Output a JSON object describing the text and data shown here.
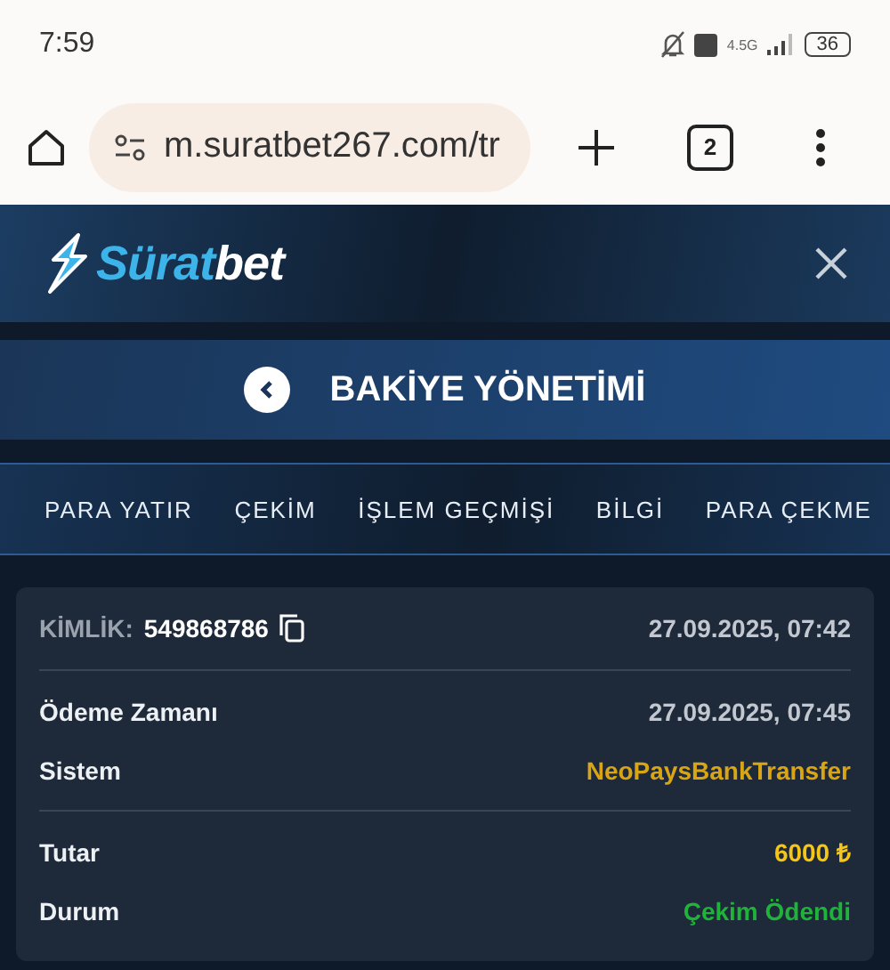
{
  "status_bar": {
    "time": "7:59",
    "network": "4.5G",
    "battery": "36"
  },
  "browser": {
    "url": "m.suratbet267.com/tr",
    "tab_count": "2"
  },
  "header": {
    "logo": [
      "Sürat",
      "bet"
    ]
  },
  "page_title": "BAKİYE YÖNETİMİ",
  "tabs": [
    {
      "label": "PARA YATIR",
      "selected": false
    },
    {
      "label": "ÇEKİM",
      "selected": false
    },
    {
      "label": "İŞLEM GEÇMİŞİ",
      "selected": false
    },
    {
      "label": "BİLGİ",
      "selected": false
    },
    {
      "label": "PARA ÇEKME",
      "selected": false
    }
  ],
  "card": {
    "id_label": "KİMLİK:",
    "id_value": "549868786",
    "date": "27.09.2025, 07:42",
    "sections": [
      {
        "rows": [
          {
            "label": "Ödeme Zamanı",
            "value": "27.09.2025, 07:45",
            "color": "#c3c8d0"
          },
          {
            "label": "Sistem",
            "value": "NeoPaysBankTransfer",
            "color": "#d9a514"
          }
        ]
      },
      {
        "rows": [
          {
            "label": "Tutar",
            "value": "6000 ₺",
            "color": "#f5c518"
          },
          {
            "label": "Durum",
            "value": "Çekim Ödendi",
            "color": "#1fb33a"
          }
        ]
      }
    ]
  }
}
